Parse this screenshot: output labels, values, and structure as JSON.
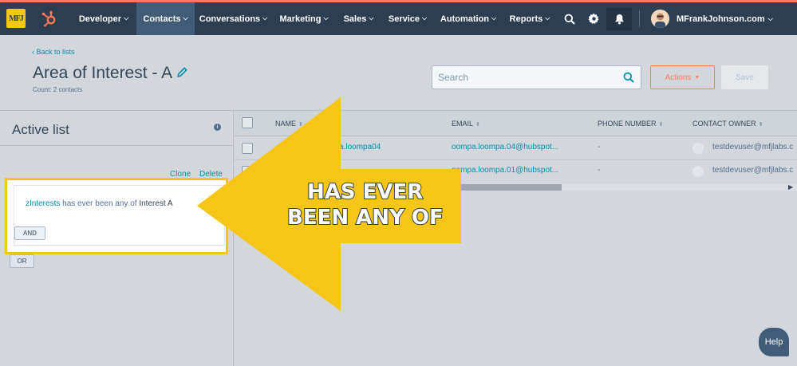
{
  "nav": {
    "logo_text": "MFJ",
    "items": [
      {
        "label": "Developer"
      },
      {
        "label": "Contacts"
      },
      {
        "label": "Conversations"
      },
      {
        "label": "Marketing"
      },
      {
        "label": "Sales"
      },
      {
        "label": "Service"
      },
      {
        "label": "Automation"
      },
      {
        "label": "Reports"
      }
    ],
    "account_label": "MFrankJohnson.com",
    "accent_color": "#ff7a59",
    "bar_color": "#2d3e50"
  },
  "header": {
    "back_link": "Back to lists",
    "title": "Area of Interest - A",
    "count": "Count: 2 contacts",
    "search_placeholder": "Search",
    "actions_label": "Actions",
    "save_label": "Save"
  },
  "filter_panel": {
    "title": "Active list",
    "clone_label": "Clone",
    "delete_label": "Delete",
    "filter": {
      "property": "zInterests",
      "operator": "has ever been any of",
      "value": "Interest A"
    },
    "and_label": "AND",
    "or_label": "OR"
  },
  "table": {
    "columns": [
      "NAME",
      "EMAIL",
      "PHONE NUMBER",
      "CONTACT OWNER"
    ],
    "rows": [
      {
        "name": "oompa.loompa04",
        "email": "oompa.loompa.04@hubspot...",
        "phone": "-",
        "owner": "testdevuser@mfjlabs.c"
      },
      {
        "name": "",
        "email": "oompa.loompa.01@hubspot...",
        "phone": "-",
        "owner": "testdevuser@mfjlabs.c"
      }
    ]
  },
  "annotation": {
    "line1": "HAS EVER",
    "line2": "BEEN ANY OF",
    "color": "#f5c518"
  },
  "help_label": "Help"
}
